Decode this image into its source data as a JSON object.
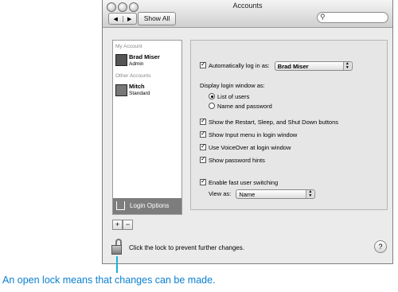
{
  "window": {
    "title": "Accounts"
  },
  "toolbar": {
    "back": "◀",
    "forward": "▶",
    "show_all": "Show All",
    "search_icon": "search-icon"
  },
  "sidebar": {
    "my_account_heading": "My Account",
    "my_account": {
      "name": "Brad Miser",
      "role": "Admin"
    },
    "other_accounts_heading": "Other Accounts",
    "other": {
      "name": "Mitch",
      "role": "Standard"
    },
    "login_options": "Login Options"
  },
  "buttons": {
    "add": "+",
    "remove": "−"
  },
  "panel": {
    "auto_login_label": "Automatically log in as:",
    "auto_login_user": "Brad Miser",
    "display_heading": "Display login window as:",
    "radio_list": "List of users",
    "radio_name": "Name and password",
    "cb_restart": "Show the Restart, Sleep, and Shut Down buttons",
    "cb_input": "Show Input menu in login window",
    "cb_voiceover": "Use VoiceOver at login window",
    "cb_hints": "Show password hints",
    "cb_fast": "Enable fast user switching",
    "view_as_label": "View as:",
    "view_as_value": "Name"
  },
  "footer": {
    "lock_text": "Click the lock to prevent further changes.",
    "help": "?"
  },
  "callout": "An open lock means that changes can be made."
}
